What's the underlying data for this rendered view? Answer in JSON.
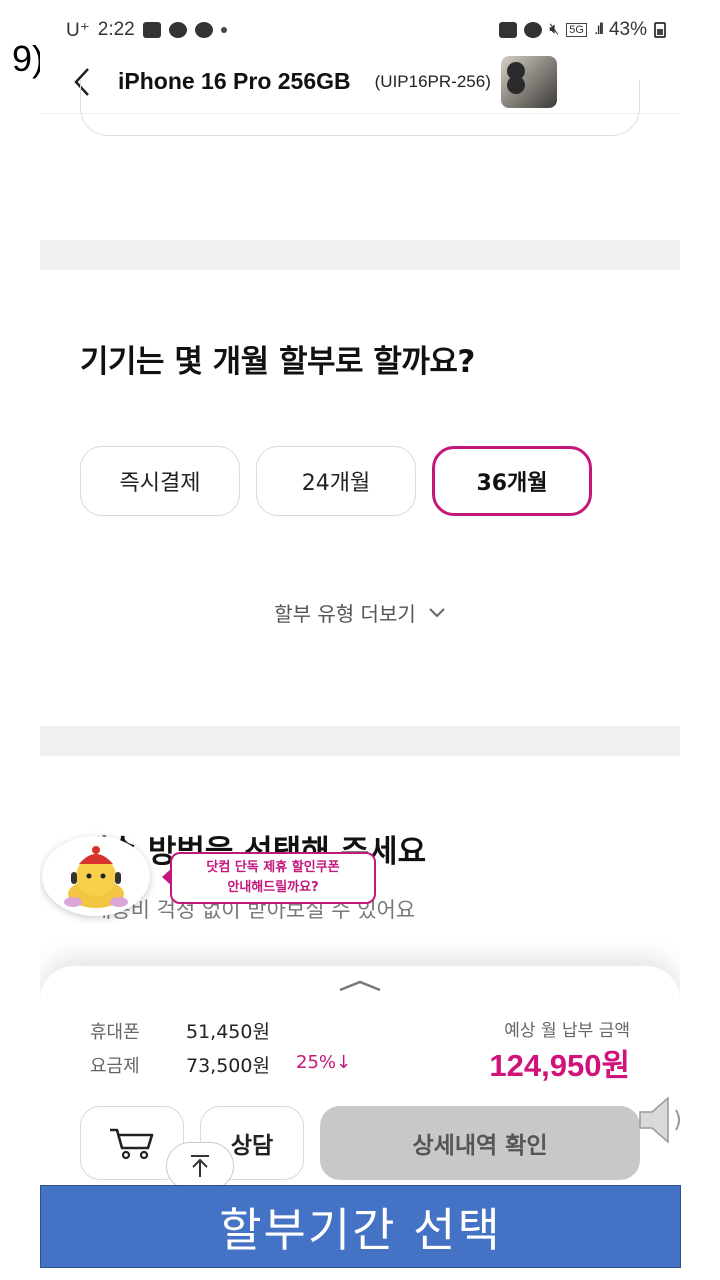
{
  "step_label": "9)",
  "status_bar": {
    "carrier": "U⁺",
    "time": "2:22",
    "network": "5G",
    "battery": "43%"
  },
  "app_bar": {
    "title": "iPhone 16 Pro 256GB",
    "model_code": "(UIP16PR-256)"
  },
  "installment": {
    "question": "기기는 몇 개월 할부로 할까요?",
    "options": [
      {
        "label": "즉시결제",
        "selected": false
      },
      {
        "label": "24개월",
        "selected": false
      },
      {
        "label": "36개월",
        "selected": true
      }
    ],
    "more_label": "할부 유형 더보기"
  },
  "shipping": {
    "title": "배송 방법을 선택해 주세요",
    "subtitle": "배송비 걱정 없이 받아보실 수 있어요"
  },
  "chatbot_bubble": {
    "line1": "닷컴 단독 제휴 할인쿠폰",
    "line2": "안내해드릴까요?"
  },
  "summary": {
    "phone_label": "휴대폰",
    "phone_price": "51,450원",
    "plan_label": "요금제",
    "plan_price": "73,500원",
    "plan_discount": "25%↓",
    "estimate_label": "예상 월 납부 금액",
    "estimate_value": "124,950원"
  },
  "actions": {
    "consult_label": "상담",
    "detail_label": "상세내역 확인"
  },
  "caption": "할부기간 선택",
  "colors": {
    "accent": "#c4177b",
    "price": "#d1127a",
    "caption_bg": "#4472c4"
  }
}
